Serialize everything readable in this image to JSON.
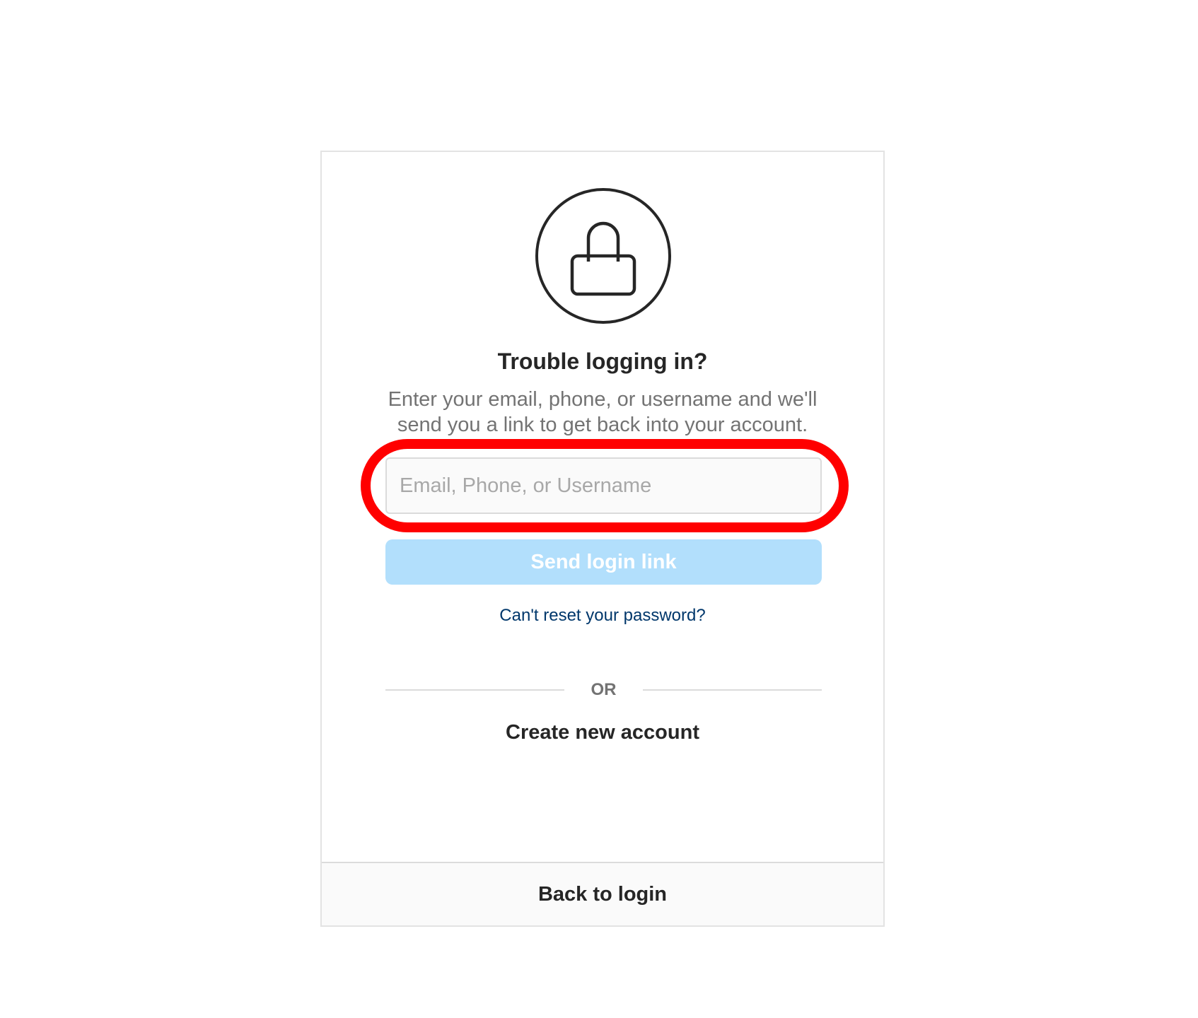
{
  "card": {
    "lock_icon": "lock-icon",
    "title": "Trouble logging in?",
    "description_line1": "Enter your email, phone, or username and we'll",
    "description_line2": "send you a link to get back into your account.",
    "input": {
      "placeholder": "Email, Phone, or Username",
      "value": ""
    },
    "send_button_label": "Send login link",
    "cant_reset_link": "Can't reset your password?",
    "divider_text": "OR",
    "create_account_link": "Create new account",
    "footer": {
      "back_to_login": "Back to login"
    }
  },
  "colors": {
    "highlight_ring": "#ff0000",
    "button_disabled": "#b2dffc",
    "link_blue": "#00376b",
    "text_primary": "#262626",
    "text_secondary": "#737373"
  }
}
